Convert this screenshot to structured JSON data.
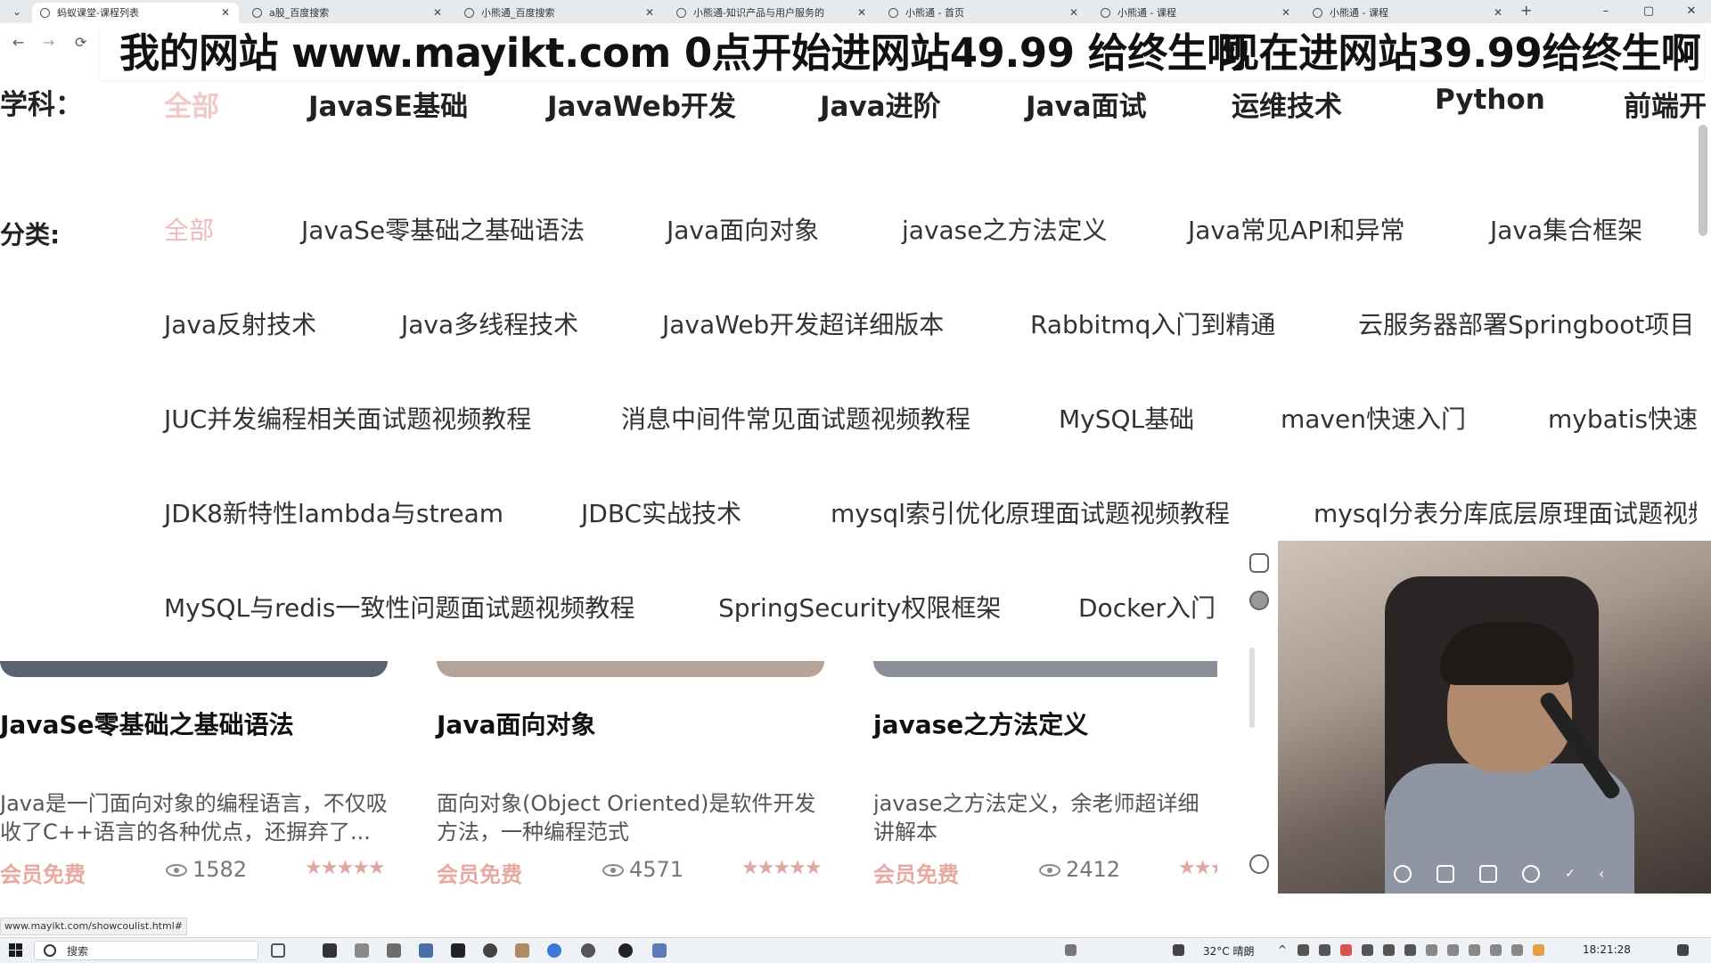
{
  "browser": {
    "tabs": [
      {
        "title": "蚂蚁课堂-课程列表",
        "active": true
      },
      {
        "title": "a股_百度搜索",
        "active": false
      },
      {
        "title": "小熊通_百度搜索",
        "active": false
      },
      {
        "title": "小熊通-知识产品与用户服务的",
        "active": false
      },
      {
        "title": "小熊通 - 首页",
        "active": false
      },
      {
        "title": "小熊通 - 课程",
        "active": false
      },
      {
        "title": "小熊通 - 课程",
        "active": false
      }
    ],
    "new_tab": "+",
    "window_controls": {
      "minimize": "–",
      "maximize": "▢",
      "close": "✕"
    },
    "nav": {
      "back": "←",
      "forward": "→",
      "reload": "⟳"
    }
  },
  "banner": {
    "text": "我的网站 www.mayikt.com 0点开始进网站49.99 给终生啊",
    "text2": "现在进网站39.99给终生啊"
  },
  "subjects": {
    "label": "学科：",
    "items": [
      "全部",
      "JavaSE基础",
      "JavaWeb开发",
      "Java进阶",
      "Java面试",
      "运维技术",
      "Python",
      "前端开"
    ]
  },
  "categories": {
    "label": "分类:",
    "rows": [
      [
        "全部",
        "JavaSe零基础之基础语法",
        "Java面向对象",
        "javase之方法定义",
        "Java常见API和异常",
        "Java集合框架"
      ],
      [
        "Java反射技术",
        "Java多线程技术",
        "JavaWeb开发超详细版本",
        "Rabbitmq入门到精通",
        "云服务器部署Springboot项目"
      ],
      [
        "JUC并发编程相关面试题视频教程",
        "消息中间件常见面试题视频教程",
        "MySQL基础",
        "maven快速入门",
        "mybatis快速"
      ],
      [
        "JDK8新特性lambda与stream",
        "JDBC实战技术",
        "mysql索引优化原理面试题视频教程",
        "mysql分表分库底层原理面试题视频"
      ],
      [
        "MySQL与redis一致性问题面试题视频教程",
        "SpringSecurity权限框架",
        "Docker入门"
      ]
    ]
  },
  "courses": [
    {
      "title": "JavaSe零基础之基础语法",
      "desc": "Java是一门面向对象的编程语言，不仅吸收了C++语言的各种优点，还摒弃了...",
      "badge": "会员免费",
      "views": "1582",
      "stars": "★★★★★",
      "rating": 5
    },
    {
      "title": "Java面向对象",
      "desc": "面向对象(Object Oriented)是软件开发方法，一种编程范式",
      "badge": "会员免费",
      "views": "4571",
      "stars": "★★★★★",
      "rating": 5
    },
    {
      "title": "javase之方法定义",
      "desc": "javase之方法定义，余老师超详细讲解本",
      "badge": "会员免费",
      "views": "2412",
      "stars": "★★★",
      "rating": 5
    }
  ],
  "status_url": "www.mayikt.com/showcoulist.html#",
  "taskbar": {
    "search_placeholder": "搜索",
    "weather": "32°C 晴朗",
    "time": "18:21:28"
  },
  "colors": {
    "accent_pink": "#e8a9a0",
    "active_tab_pink": "#f2c9c9"
  }
}
